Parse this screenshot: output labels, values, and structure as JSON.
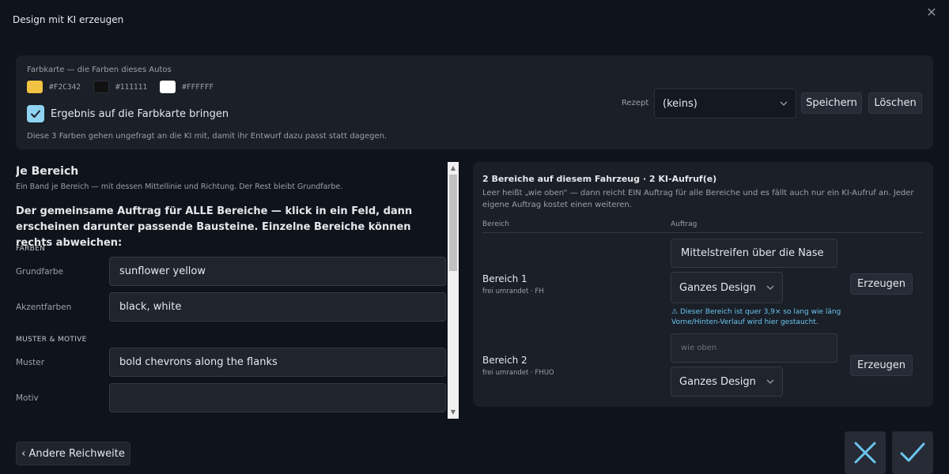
{
  "dialog": {
    "title": "Design mit KI erzeugen",
    "close_icon": "close-icon"
  },
  "colorcard": {
    "title": "Farbkarte — die Farben dieses Autos",
    "swatches": [
      {
        "color": "#F2C342",
        "label": "#F2C342"
      },
      {
        "color": "#111111",
        "label": "#111111"
      },
      {
        "color": "#FFFFFF",
        "label": "#FFFFFF"
      }
    ],
    "apply_checkbox": {
      "checked": true,
      "label": "Ergebnis auf die Farbkarte bringen"
    },
    "note": "Diese 3 Farben gehen ungefragt an die KI mit, damit ihr Entwurf dazu passt statt dagegen.",
    "rezept_label": "Rezept",
    "rezept_value": "(keins)",
    "save_label": "Speichern",
    "delete_label": "Löschen"
  },
  "left": {
    "heading": "Je Bereich",
    "subheading": "Ein Band je Bereich — mit dessen Mittellinie und Richtung. Der Rest bleibt Grundfarbe.",
    "instruction": "Der gemeinsame Auftrag für ALLE Bereiche — klick in ein Feld, dann erscheinen darunter passende Bausteine. Einzelne Bereiche können rechts abweichen:",
    "section_colors": "FARBEN",
    "grundfarbe_label": "Grundfarbe",
    "grundfarbe_value": "sunflower yellow",
    "akzent_label": "Akzentfarben",
    "akzent_value": "black, white",
    "section_muster": "MUSTER & MOTIVE",
    "muster_label": "Muster",
    "muster_value": "bold chevrons along the flanks",
    "motiv_label": "Motiv",
    "motiv_value": ""
  },
  "right": {
    "heading": "2 Bereiche auf diesem Fahrzeug · 2 KI-Aufruf(e)",
    "description": "Leer heißt „wie oben“ — dann reicht EIN Auftrag für alle Bereiche und es fällt auch nur ein KI-Aufruf an. Jeder eigene Auftrag kostet einen weiteren.",
    "col_area": "Bereich",
    "col_task": "Auftrag",
    "areas": [
      {
        "name": "Bereich 1",
        "sub": "frei umrandet · FH",
        "task_value": "Mittelstreifen über die Nase",
        "task_placeholder": "",
        "scope": "Ganzes Design",
        "button": "Erzeugen",
        "warning": "Dieser Bereich ist quer 3,9× so lang wie läng Vorne/Hinten-Verlauf wird hier gestaucht."
      },
      {
        "name": "Bereich 2",
        "sub": "frei umrandet · FHUO",
        "task_value": "",
        "task_placeholder": "wie oben",
        "scope": "Ganzes Design",
        "button": "Erzeugen"
      }
    ]
  },
  "footer": {
    "back_label": "‹ Andere Reichweite",
    "cancel_icon": "cancel-x-icon",
    "confirm_icon": "confirm-check-icon"
  },
  "colors": {
    "accent": "#6cc5ef",
    "checkbox": "#8fd3f0"
  }
}
